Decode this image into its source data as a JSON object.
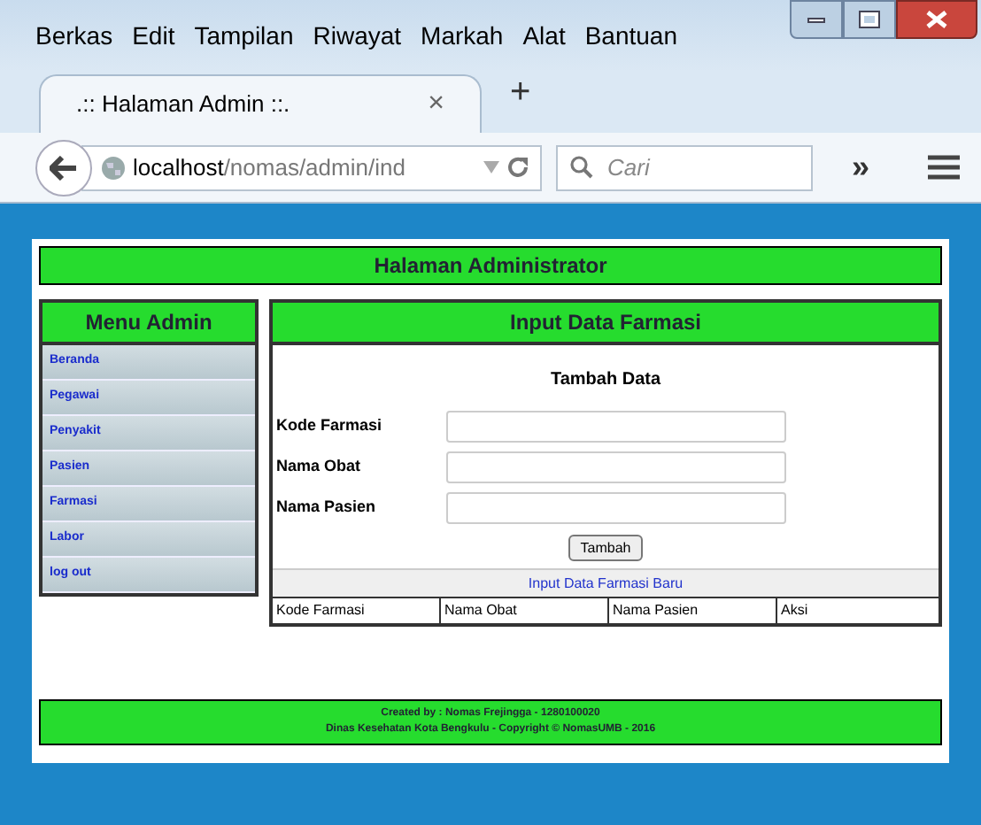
{
  "menu_bar": [
    "Berkas",
    "Edit",
    "Tampilan",
    "Riwayat",
    "Markah",
    "Alat",
    "Bantuan"
  ],
  "tab": {
    "title": ".:: Halaman Admin ::.",
    "close": "×",
    "new_tab": "+"
  },
  "address_bar": {
    "host": "localhost",
    "path": "/nomas/admin/ind"
  },
  "search": {
    "placeholder": "Cari"
  },
  "overflow": "»",
  "page": {
    "header": "Halaman Administrator",
    "sidebar": {
      "title": "Menu Admin",
      "items": [
        "Beranda",
        "Pegawai",
        "Penyakit",
        "Pasien",
        "Farmasi",
        "Labor",
        "log out"
      ]
    },
    "panel": {
      "title": "Input Data Farmasi",
      "form_title": "Tambah Data",
      "fields": [
        {
          "label": "Kode Farmasi"
        },
        {
          "label": "Nama Obat"
        },
        {
          "label": "Nama Pasien"
        }
      ],
      "submit": "Tambah",
      "link": "Input Data Farmasi Baru",
      "table": {
        "columns": [
          "Kode Farmasi",
          "Nama Obat",
          "Nama Pasien",
          "Aksi"
        ]
      }
    },
    "footer": [
      "Created by : Nomas Frejingga - 1280100020",
      "Dinas Kesehatan Kota Bengkulu - Copyright © NomasUMB - 2016"
    ]
  }
}
